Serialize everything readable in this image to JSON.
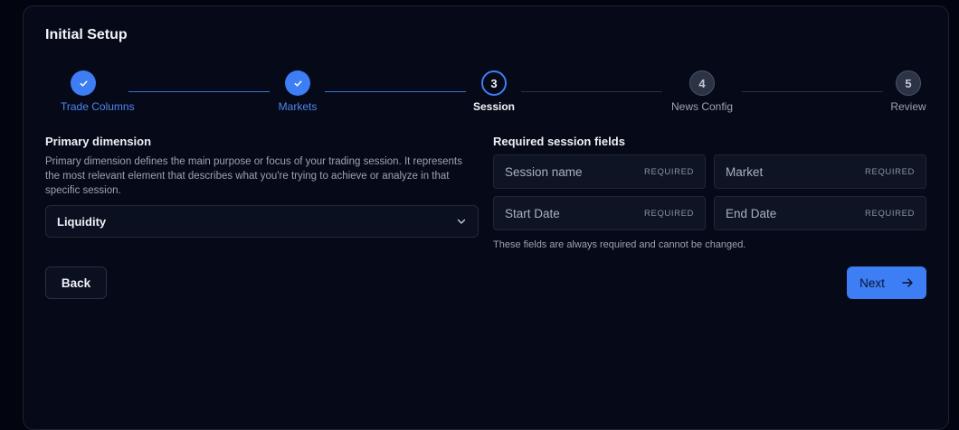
{
  "title": "Initial Setup",
  "stepper": {
    "steps": [
      {
        "number": "1",
        "label": "Trade Columns",
        "state": "done"
      },
      {
        "number": "2",
        "label": "Markets",
        "state": "done"
      },
      {
        "number": "3",
        "label": "Session",
        "state": "active"
      },
      {
        "number": "4",
        "label": "News Config",
        "state": "todo"
      },
      {
        "number": "5",
        "label": "Review",
        "state": "todo"
      }
    ]
  },
  "primary": {
    "heading": "Primary dimension",
    "description": "Primary dimension defines the main purpose or focus of your trading session. It represents the most relevant element that describes what you're trying to achieve or analyze in that specific session.",
    "selected_value": "Liquidity",
    "icon": "chevron-down-icon"
  },
  "required": {
    "heading": "Required session fields",
    "tag": "REQUIRED",
    "fields": [
      {
        "name": "Session name"
      },
      {
        "name": "Market"
      },
      {
        "name": "Start Date"
      },
      {
        "name": "End Date"
      }
    ],
    "note": "These fields are always required and cannot be changed."
  },
  "buttons": {
    "back": "Back",
    "next": "Next",
    "next_icon": "arrow-right-icon"
  },
  "colors": {
    "accent": "#3d7ef5",
    "background": "#020510",
    "panel": "#060a18"
  }
}
